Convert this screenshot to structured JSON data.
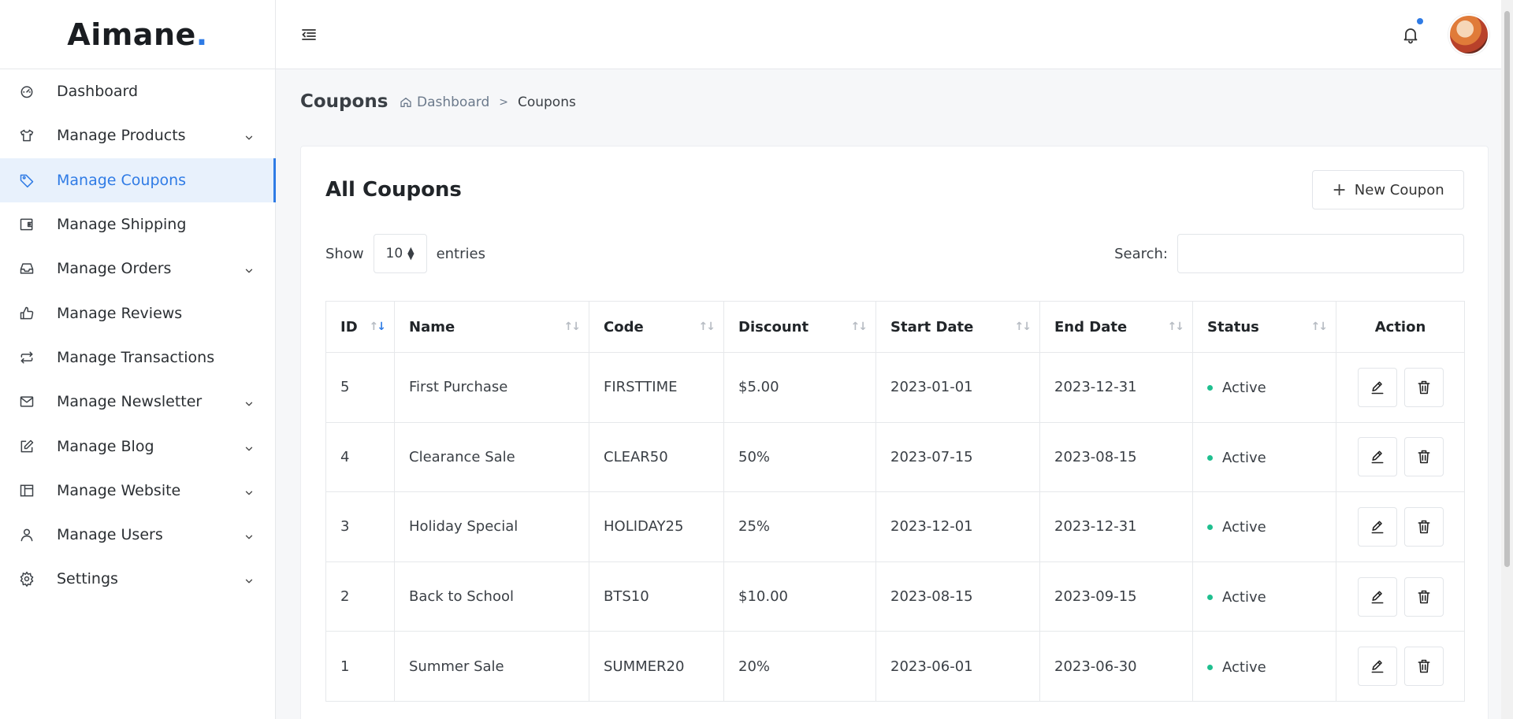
{
  "brand": {
    "name": "Aimane",
    "dot": ".",
    "accent": "#2f7be5"
  },
  "sidebar": {
    "items": [
      {
        "label": "Dashboard",
        "icon": "dashboard-icon",
        "has_children": false,
        "active": false
      },
      {
        "label": "Manage Products",
        "icon": "shirt-icon",
        "has_children": true,
        "active": false
      },
      {
        "label": "Manage Coupons",
        "icon": "tag-icon",
        "has_children": false,
        "active": true
      },
      {
        "label": "Manage Shipping",
        "icon": "wallet-icon",
        "has_children": false,
        "active": false
      },
      {
        "label": "Manage Orders",
        "icon": "inbox-icon",
        "has_children": true,
        "active": false
      },
      {
        "label": "Manage Reviews",
        "icon": "thumbs-up-icon",
        "has_children": false,
        "active": false
      },
      {
        "label": "Manage Transactions",
        "icon": "repeat-icon",
        "has_children": false,
        "active": false
      },
      {
        "label": "Manage Newsletter",
        "icon": "mail-icon",
        "has_children": true,
        "active": false
      },
      {
        "label": "Manage Blog",
        "icon": "edit-icon",
        "has_children": true,
        "active": false
      },
      {
        "label": "Manage Website",
        "icon": "layout-icon",
        "has_children": true,
        "active": false
      },
      {
        "label": "Manage Users",
        "icon": "user-icon",
        "has_children": true,
        "active": false
      },
      {
        "label": "Settings",
        "icon": "gear-icon",
        "has_children": true,
        "active": false
      }
    ]
  },
  "header": {
    "page_title": "Coupons",
    "breadcrumb": {
      "home": "Dashboard",
      "separator": ">",
      "current": "Coupons"
    }
  },
  "card": {
    "title": "All Coupons",
    "new_button": "New Coupon",
    "show_label": "Show",
    "entries_value": "10",
    "entries_label": "entries",
    "search_label": "Search:",
    "search_value": ""
  },
  "table": {
    "columns": [
      "ID",
      "Name",
      "Code",
      "Discount",
      "Start Date",
      "End Date",
      "Status",
      "Action"
    ],
    "rows": [
      {
        "id": "5",
        "name": "First Purchase",
        "code": "FIRSTTIME",
        "discount": "$5.00",
        "start": "2023-01-01",
        "end": "2023-12-31",
        "status": "Active"
      },
      {
        "id": "4",
        "name": "Clearance Sale",
        "code": "CLEAR50",
        "discount": "50%",
        "start": "2023-07-15",
        "end": "2023-08-15",
        "status": "Active"
      },
      {
        "id": "3",
        "name": "Holiday Special",
        "code": "HOLIDAY25",
        "discount": "25%",
        "start": "2023-12-01",
        "end": "2023-12-31",
        "status": "Active"
      },
      {
        "id": "2",
        "name": "Back to School",
        "code": "BTS10",
        "discount": "$10.00",
        "start": "2023-08-15",
        "end": "2023-09-15",
        "status": "Active"
      },
      {
        "id": "1",
        "name": "Summer Sale",
        "code": "SUMMER20",
        "discount": "20%",
        "start": "2023-06-01",
        "end": "2023-06-30",
        "status": "Active"
      }
    ]
  },
  "colors": {
    "accent": "#2f7be5",
    "status_active": "#1fbf8f",
    "active_bg": "#e8f1fc"
  }
}
